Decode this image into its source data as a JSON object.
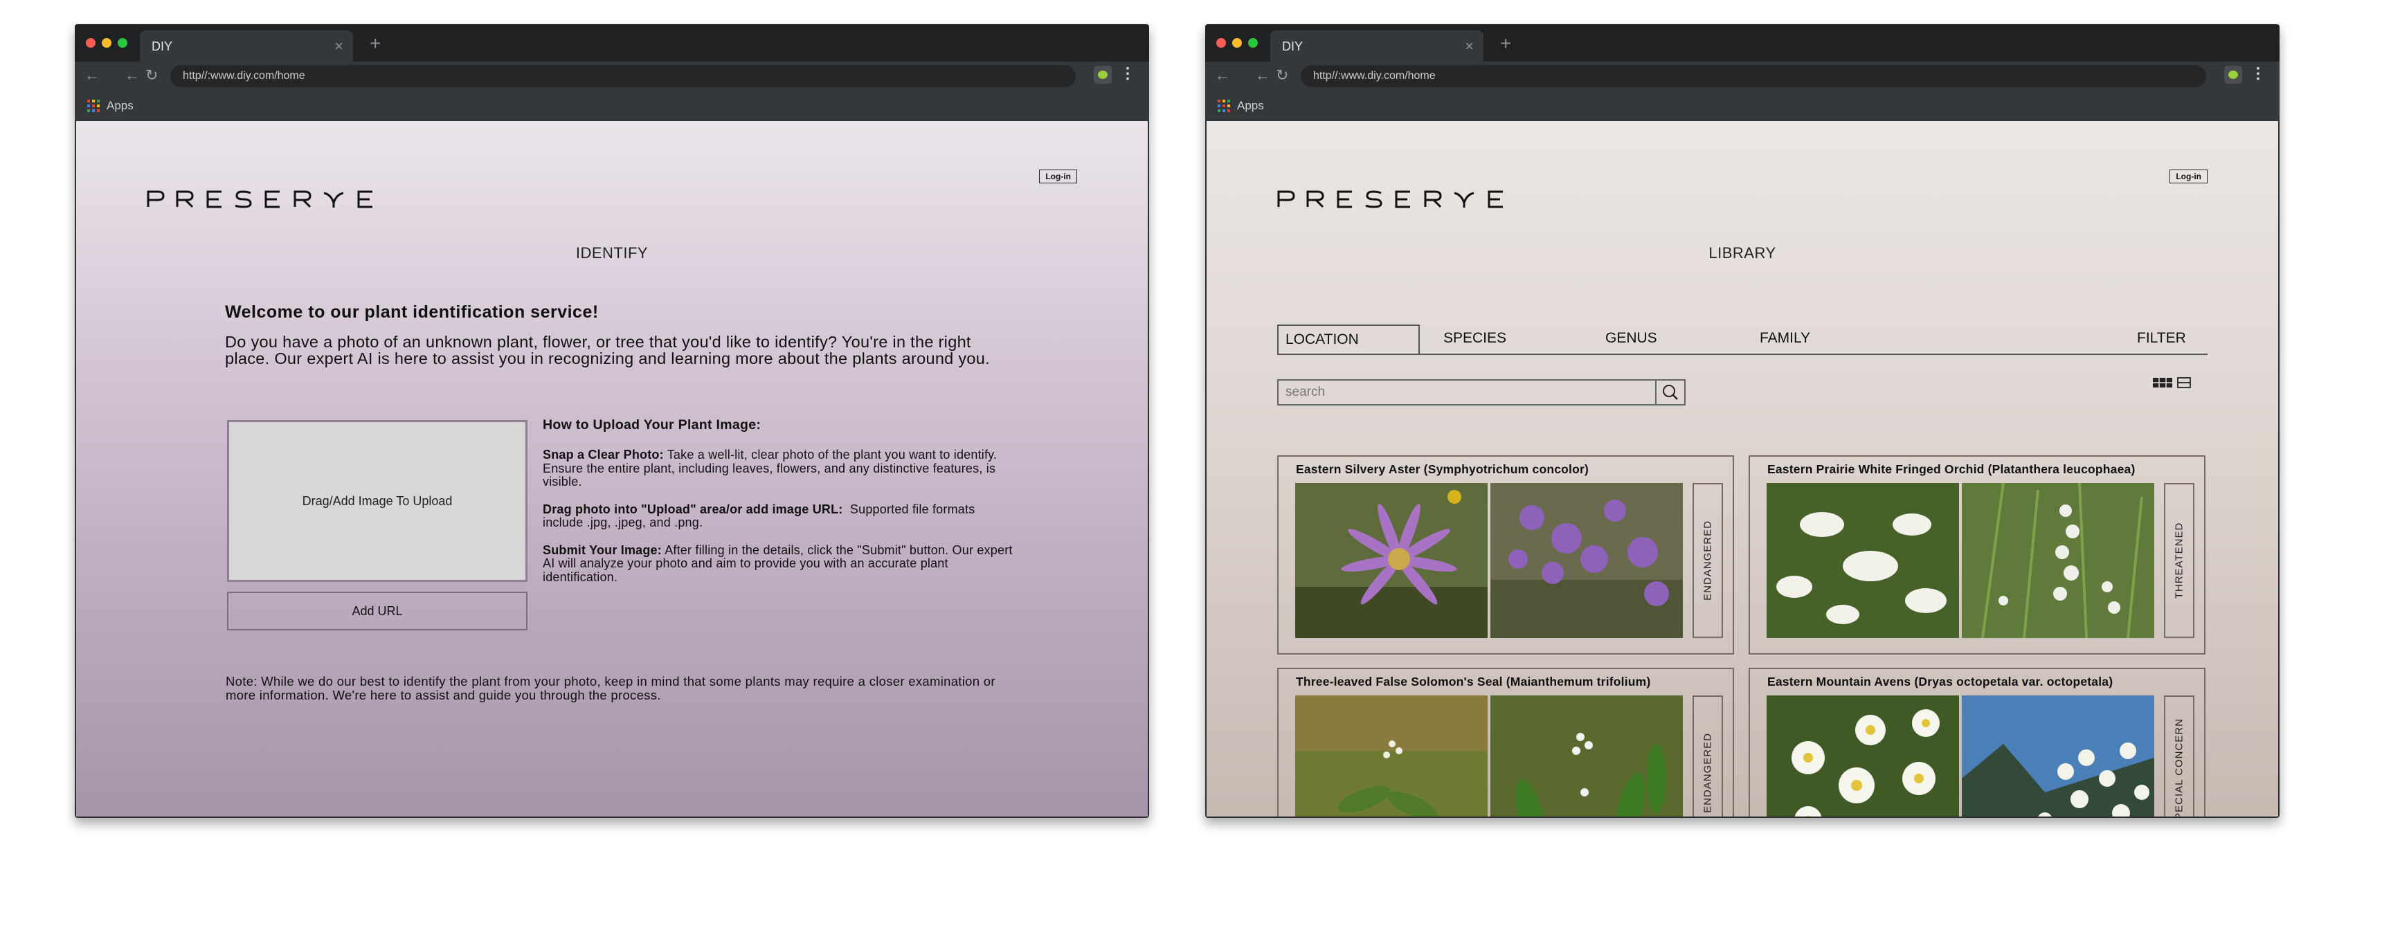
{
  "windows": [
    {
      "tab_title": "DIY",
      "url": "http//:www.diy.com/home",
      "bookmark": "Apps",
      "login": "Log-in",
      "page_title": "IDENTIFY",
      "welcome": "Welcome to our plant identification service!",
      "intro": "Do you have a photo of an unknown plant, flower, or tree that you'd like to identify? You're in the right place. Our expert AI is here to assist you in recognizing and learning more about the plants around you.",
      "dropzone": "Drag/Add Image To Upload",
      "add_url": "Add URL",
      "howto_title": "How to Upload Your Plant Image:",
      "steps": [
        {
          "title": "Snap a Clear Photo:",
          "text": "Take a well-lit, clear photo of the plant you want to identify. Ensure the entire plant, including leaves, flowers, and any distinctive features, is visible."
        },
        {
          "title": "Drag photo into \"Upload\" area/or add image URL:",
          "text": "Supported file formats include .jpg, .jpeg, and .png."
        },
        {
          "title": "Submit Your Image:",
          "text": "After filling in the details, click the \"Submit\" button. Our expert AI will analyze your photo and aim to provide you with an accurate plant identification."
        }
      ],
      "note": "Note: While we do our best to identify the plant from your photo, keep in mind that some plants may require a closer examination or more information. We're here to assist and guide you through the process."
    },
    {
      "tab_title": "DIY",
      "url": "http//:www.diy.com/home",
      "bookmark": "Apps",
      "login": "Log-in",
      "page_title": "LIBRARY",
      "tabs": [
        "LOCATION",
        "SPECIES",
        "GENUS",
        "FAMILY",
        "FILTER"
      ],
      "search_placeholder": "search",
      "cards": [
        {
          "title": "Eastern Silvery Aster (Symphyotrichum concolor)",
          "status": "ENDANGERED"
        },
        {
          "title": "Eastern Prairie White Fringed Orchid (Platanthera leucophaea)",
          "status": "THREATENED"
        },
        {
          "title": "Three-leaved False Solomon's Seal (Maianthemum trifolium)",
          "status": "ENDANGERED"
        },
        {
          "title": "Eastern Mountain Avens (Dryas octopetala var. octopetala)",
          "status": "SPECIAL CONCERN"
        }
      ]
    }
  ],
  "colors": {
    "titlebar": "#1f2123",
    "toolbar": "#35383b",
    "identify_bg": "#c9b9cb",
    "library_bg": "#ded5d1"
  },
  "icons": [
    "back-icon",
    "forward-icon",
    "reload-icon",
    "apps-icon",
    "extension-icon",
    "menu-icon",
    "search-icon",
    "grid-view-icon",
    "list-view-icon",
    "close-icon",
    "new-tab-icon"
  ]
}
